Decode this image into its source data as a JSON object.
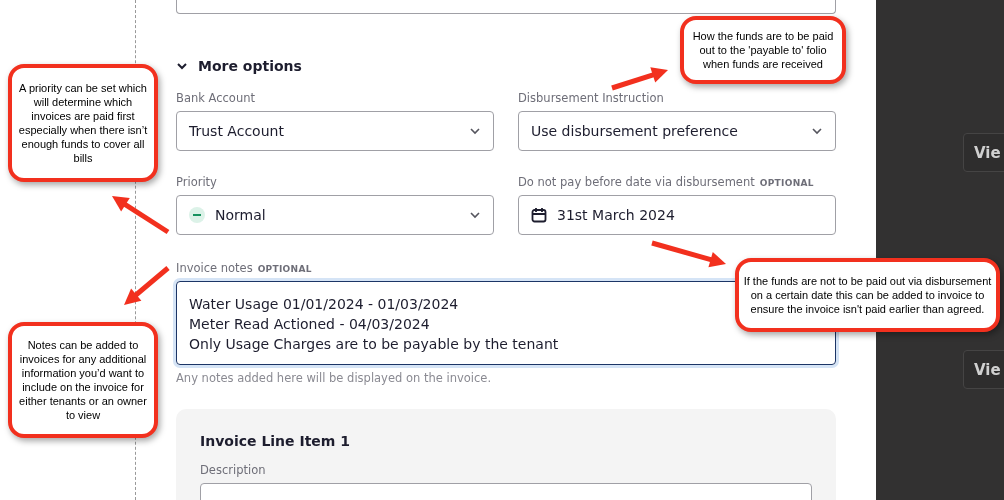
{
  "more_options": {
    "label": "More options",
    "expanded": true
  },
  "fields": [
    {
      "kind": "select",
      "label": "Bank Account",
      "value": "Trust Account"
    },
    {
      "kind": "select",
      "label": "Disbursement Instruction",
      "value": "Use disbursement preference"
    },
    {
      "kind": "priority",
      "label": "Priority",
      "value": "Normal"
    },
    {
      "kind": "date",
      "label": "Do not pay before date via disbursement",
      "tag": "OPTIONAL",
      "value": "31st March 2024"
    }
  ],
  "notes": {
    "label": "Invoice notes",
    "tag": "OPTIONAL",
    "lines": [
      "Water Usage 01/01/2024 - 01/03/2024",
      "Meter Read Actioned - 04/03/2024",
      "Only Usage Charges are to be payable by the tenant"
    ],
    "help": "Any notes added here will be displayed on the invoice."
  },
  "line_item": {
    "title": "Invoice Line Item 1",
    "description_label": "Description"
  },
  "side_buttons": [
    "Vie",
    "Vie"
  ],
  "callouts": [
    "How the funds are to be paid out to the 'payable to' folio when funds are received",
    "A priority can be set which will determine which invoices are paid first especially when there isn’t enough funds to cover all bills",
    "If the funds are not to be paid out via disbursement on a certain date this can be added to invoice to ensure the invoice isn't paid earlier than agreed.",
    "Notes can be added to invoices for any additional information you’d want to include on the invoice for either tenants or an owner to view"
  ]
}
